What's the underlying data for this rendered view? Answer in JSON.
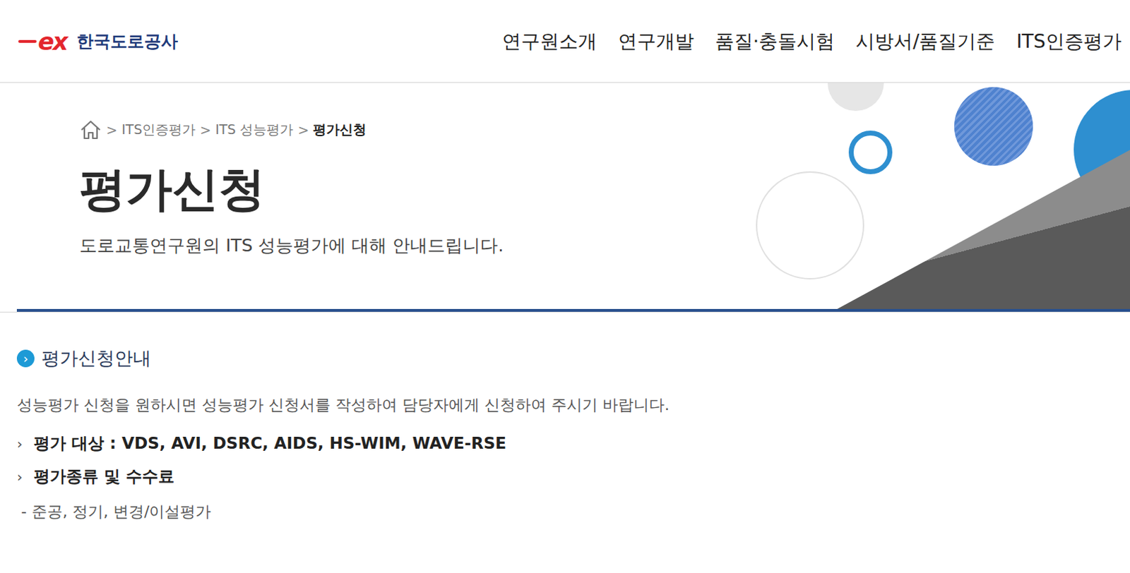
{
  "logo": {
    "mark": "ex",
    "name": "한국도로공사"
  },
  "nav": [
    "연구원소개",
    "연구개발",
    "품질·충돌시험",
    "시방서/품질기준",
    "ITS인증평가"
  ],
  "breadcrumb": {
    "separator": ">",
    "items": [
      {
        "label": "ITS인증평가",
        "current": false
      },
      {
        "label": "ITS 성능평가",
        "current": false
      },
      {
        "label": "평가신청",
        "current": true
      }
    ]
  },
  "page": {
    "title": "평가신청",
    "subtitle": "도로교통연구원의 ITS 성능평가에 대해 안내드립니다."
  },
  "section": {
    "icon": "›",
    "title": "평가신청안내",
    "intro": "성능평가 신청을 원하시면 성능평가 신청서를 작성하여 담당자에게 신청하여 주시기 바랍니다.",
    "items": [
      {
        "bullet": "›",
        "label": "평가 대상 : VDS, AVI, DSRC, AIDS, HS-WIM, WAVE-RSE"
      },
      {
        "bullet": "›",
        "label": "평가종류 및 수수료"
      }
    ],
    "note": "- 준공, 정기, 변경/이설평가"
  }
}
